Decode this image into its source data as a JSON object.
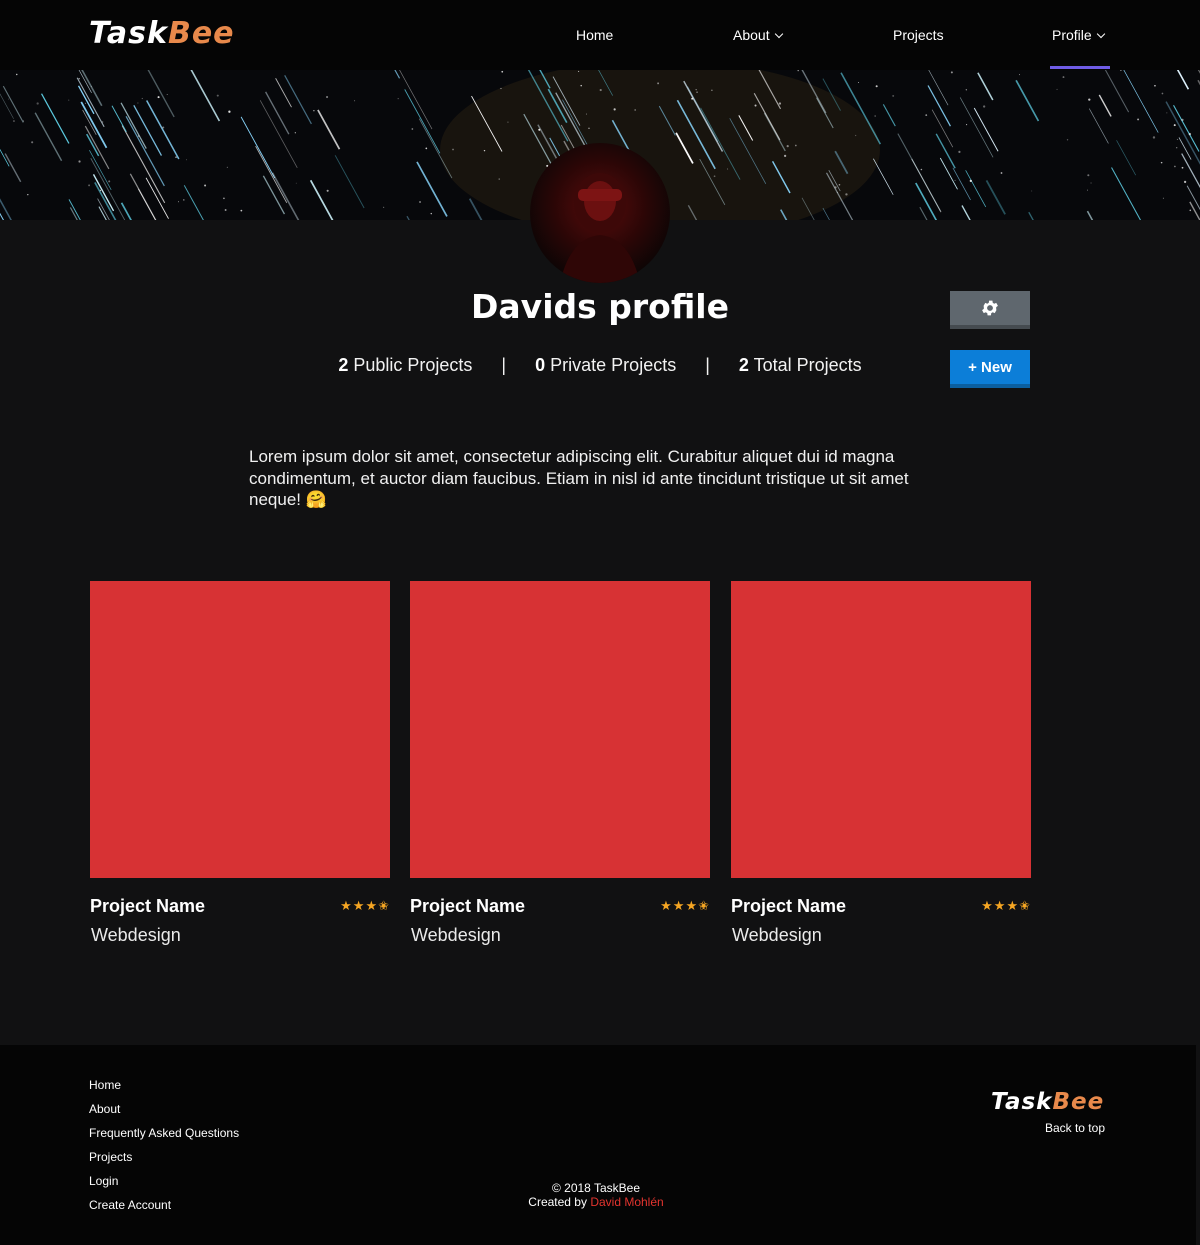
{
  "navbar": {
    "logo_part1": "Task",
    "logo_part2": "Bee",
    "items": [
      {
        "label": "Home"
      },
      {
        "label": "About"
      },
      {
        "label": "Projects"
      },
      {
        "label": "Profile"
      }
    ],
    "active_item": "Profile",
    "underline_color": "#6f5ce6"
  },
  "profile": {
    "title": "Davids profile",
    "stats": [
      {
        "count": "2",
        "label": "Public Projects"
      },
      {
        "count": "0",
        "label": "Private Projects"
      },
      {
        "count": "2",
        "label": "Total Projects"
      }
    ],
    "separator": "|",
    "settings_icon": "gear-icon",
    "new_button_label": "+ New",
    "bio": "Lorem ipsum dolor sit amet, consectetur adipiscing elit. Curabitur aliquet dui id magna condimentum, et auctor diam faucibus. Etiam in nisl id ante tincidunt tristique ut sit amet neque! 🤗"
  },
  "projects": [
    {
      "name": "Project Name",
      "category": "Webdesign",
      "rating": 3.5,
      "stars": "★★★✬"
    },
    {
      "name": "Project Name",
      "category": "Webdesign",
      "rating": 3.5,
      "stars": "★★★✬"
    },
    {
      "name": "Project Name",
      "category": "Webdesign",
      "rating": 3.5,
      "stars": "★★★✬"
    }
  ],
  "footer": {
    "links": [
      "Home",
      "About",
      "Frequently Asked Questions",
      "Projects",
      "Login",
      "Create Account"
    ],
    "logo_part1": "Task",
    "logo_part2": "Bee",
    "back_to_top": "Back to top",
    "copyright": "© 2018 TaskBee",
    "created_by": "Created by",
    "author": "David Mohlén"
  },
  "colors": {
    "card_red": "#d73234",
    "accent_orange": "#e8894b",
    "new_button_blue": "#0c7ed8",
    "settings_gray": "#5f676e",
    "star_gold": "#f5a623",
    "author_red": "#e3342f"
  }
}
